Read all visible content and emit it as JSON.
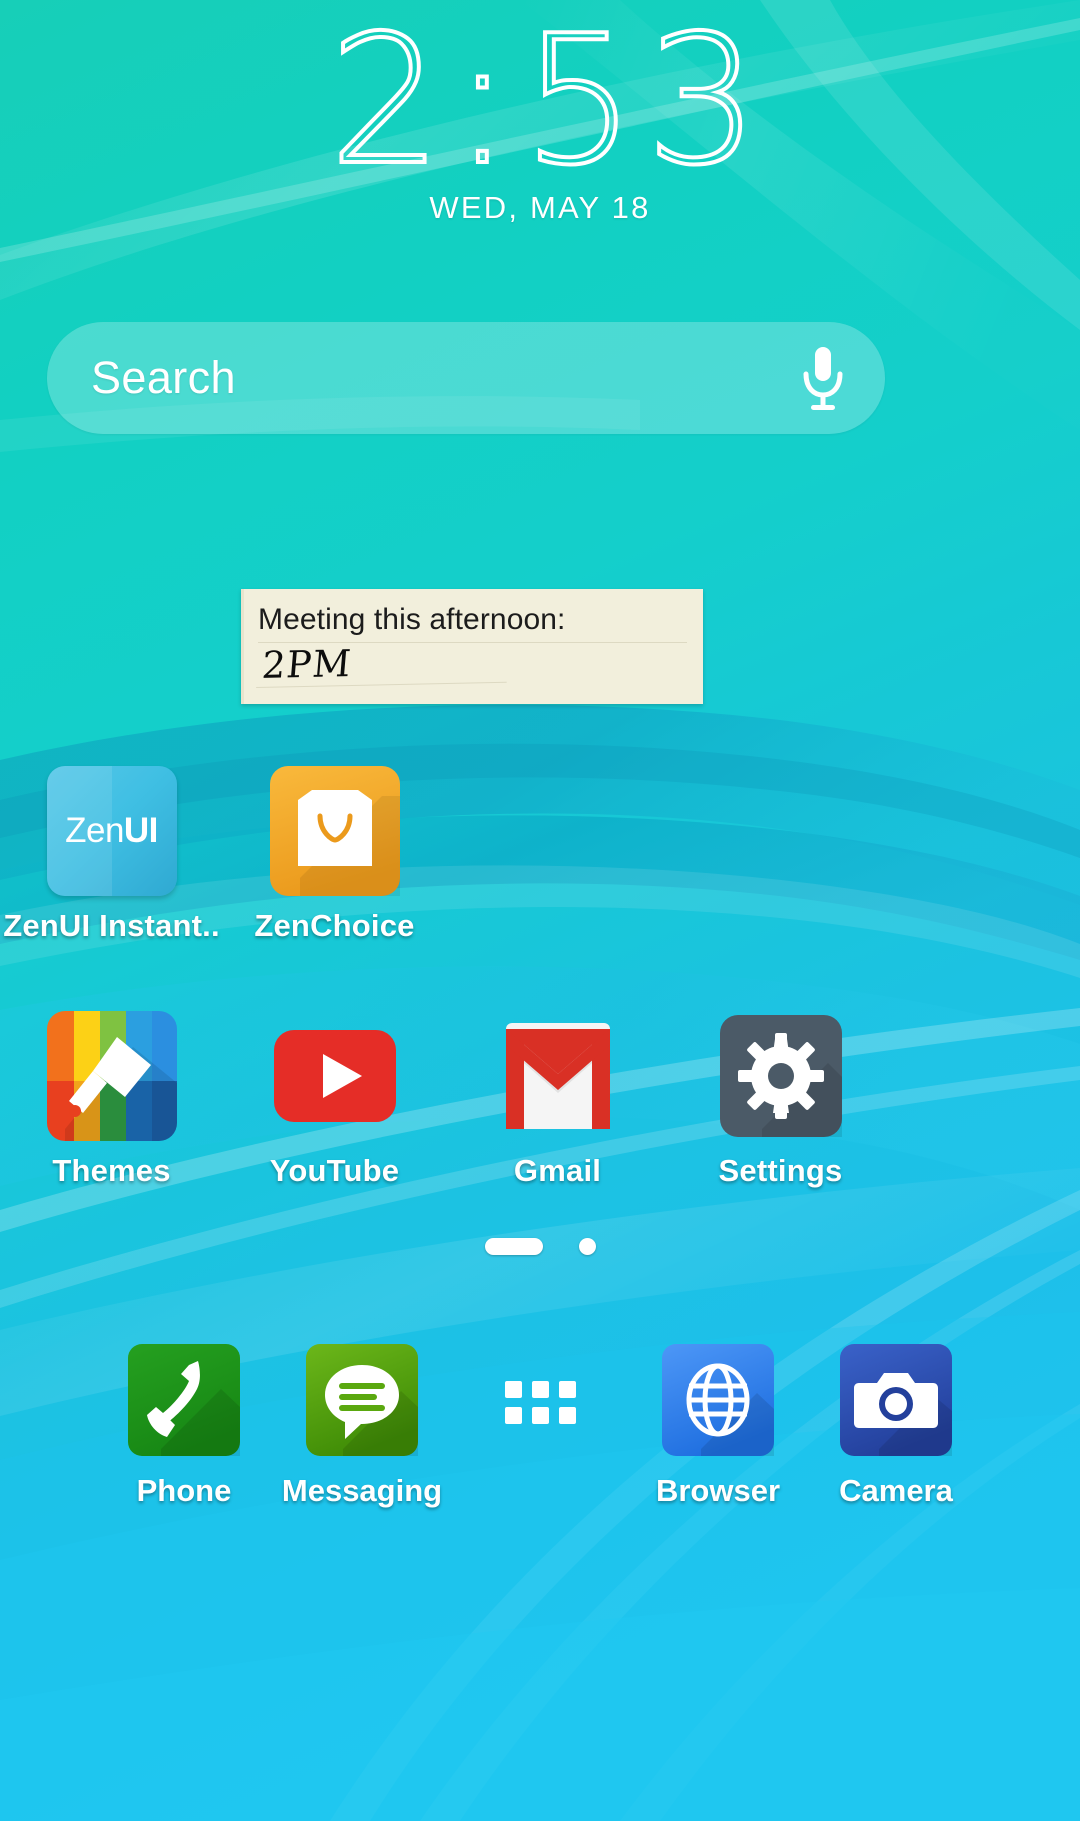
{
  "clock": {
    "time": "2:53",
    "date": "WED, MAY 18"
  },
  "search": {
    "placeholder": "Search",
    "mic_icon": "microphone-icon"
  },
  "note_widget": {
    "line1": "Meeting this afternoon:",
    "line2": "2PM"
  },
  "home_apps": [
    {
      "label": "ZenUI Instant..",
      "icon": "zenui-icon",
      "color": "#3fbfe3"
    },
    {
      "label": "ZenChoice",
      "icon": "shopping-bag-icon",
      "color": "#f5a623"
    },
    {
      "label": "",
      "icon": "",
      "color": ""
    },
    {
      "label": "",
      "icon": "",
      "color": ""
    },
    {
      "label": "Themes",
      "icon": "paintbrush-icon",
      "color": "#ef5223"
    },
    {
      "label": "YouTube",
      "icon": "play-icon",
      "color": "#e52d27"
    },
    {
      "label": "Gmail",
      "icon": "envelope-icon",
      "color": "#d44638"
    },
    {
      "label": "Settings",
      "icon": "gear-icon",
      "color": "#455a64"
    }
  ],
  "page_indicator": {
    "pages": 2,
    "active_page": 1
  },
  "dock": [
    {
      "label": "Phone",
      "icon": "phone-handset-icon",
      "color": "#1f9b1f"
    },
    {
      "label": "Messaging",
      "icon": "speech-bubble-icon",
      "color": "#57a800"
    },
    {
      "label": "",
      "icon": "app-drawer-icon",
      "color": "#ffffff"
    },
    {
      "label": "Browser",
      "icon": "globe-icon",
      "color": "#2b7de9"
    },
    {
      "label": "Camera",
      "icon": "camera-icon",
      "color": "#2f53b5"
    }
  ],
  "colors": {
    "wallpaper_top": "#13cfbe",
    "wallpaper_bottom": "#1fc0e8",
    "note_paper": "#f2efdc",
    "label_text": "#ffffff"
  }
}
